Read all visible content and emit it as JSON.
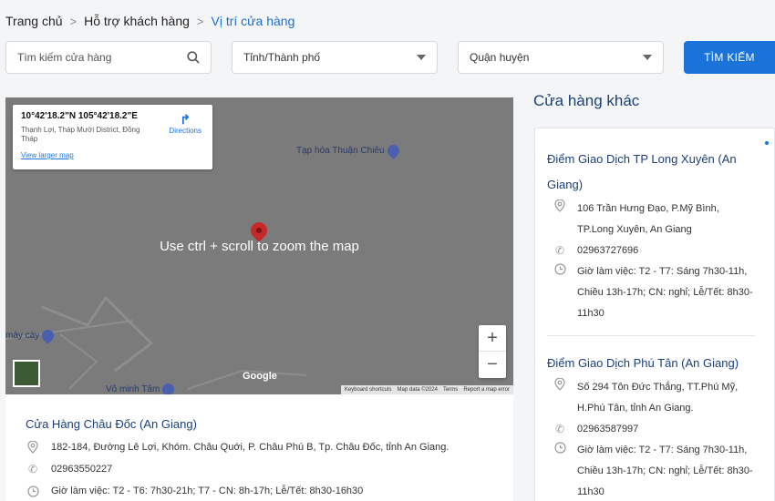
{
  "breadcrumb": {
    "home": "Trang chủ",
    "support": "Hỗ trợ khách hàng",
    "current": "Vị trí cửa hàng"
  },
  "filters": {
    "search_placeholder": "Tìm kiếm cửa hàng",
    "city": "Tỉnh/Thành phố",
    "district": "Quận huyện",
    "search_button": "TÌM KIẾM"
  },
  "map": {
    "coords": "10°42'18.2\"N 105°42'18.2\"E",
    "address": "Thạnh Lợi, Tháp Mười District, Đồng Tháp",
    "directions": "Directions",
    "view_larger": "View larger map",
    "overlay": "Use ctrl + scroll to zoom the map",
    "poi_1": "Tạp hóa Thuận Chiêu",
    "poi_2": "máy cày",
    "poi_3": "Võ minh Tâm",
    "zoom_in": "+",
    "zoom_out": "−",
    "google": "Google",
    "footer": [
      "Keyboard shortcuts",
      "Map data ©2024",
      "Terms",
      "Report a map error"
    ]
  },
  "main_store": {
    "name": "Cửa Hàng Châu Đốc (An Giang)",
    "address": "182-184, Đường Lê Lợi, Khóm. Châu Quới,  P. Châu Phú B, Tp. Châu Đốc, tỉnh An Giang.",
    "phone": "02963550227",
    "hours": "Giờ làm việc: T2 - T6: 7h30-21h; T7 - CN: 8h-17h; Lễ/Tết: 8h30-16h30"
  },
  "other_stores": {
    "title": "Cửa hàng khác",
    "items": [
      {
        "name": "Điểm Giao Dịch TP Long Xuyên (An Giang)",
        "address": "106 Trần Hưng Đạo, P.Mỹ Bình, TP.Long Xuyên, An Giang",
        "phone": "02963727696",
        "hours": "Giờ làm việc: T2 - T7: Sáng 7h30-11h, Chiều 13h-17h; CN: nghỉ; Lễ/Tết: 8h30-11h30"
      },
      {
        "name": "Điểm Giao Dịch Phú Tân (An Giang)",
        "address": "Số 294 Tôn Đức Thắng, TT.Phú Mỹ, H.Phú Tân, tỉnh An Giang.",
        "phone": "02963587997",
        "hours": "Giờ làm việc: T2 - T7: Sáng 7h30-11h, Chiều 13h-17h; CN: nghỉ; Lễ/Tết: 8h30-11h30"
      }
    ]
  },
  "colors": {
    "accent": "#1a73d9",
    "title": "#1a3f7a",
    "map_bg": "#7b7b7b"
  }
}
